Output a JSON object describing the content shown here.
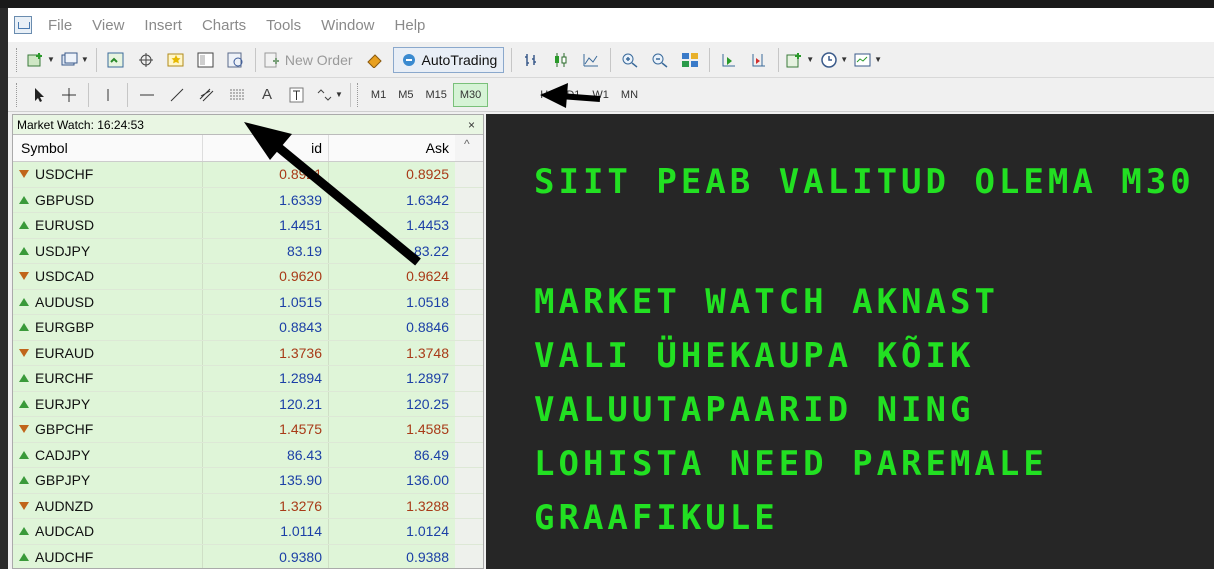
{
  "menu": {
    "items": [
      "File",
      "View",
      "Insert",
      "Charts",
      "Tools",
      "Window",
      "Help"
    ]
  },
  "toolbar1": {
    "new_order_label": "New Order",
    "autotrading_label": "AutoTrading"
  },
  "toolbar2": {
    "timeframes": [
      "M1",
      "M5",
      "M15",
      "M30",
      "H4",
      "D1",
      "W1",
      "MN"
    ],
    "active_timeframe": "M30"
  },
  "market_watch": {
    "title": "Market Watch: 16:24:53",
    "close_label": "×",
    "columns": {
      "symbol": "Symbol",
      "bid": "id",
      "ask": "Ask"
    },
    "rows": [
      {
        "symbol": "USDCHF",
        "dir": "down",
        "bid": "0.8921",
        "ask": "0.8925"
      },
      {
        "symbol": "GBPUSD",
        "dir": "up",
        "bid": "1.6339",
        "ask": "1.6342"
      },
      {
        "symbol": "EURUSD",
        "dir": "up",
        "bid": "1.4451",
        "ask": "1.4453"
      },
      {
        "symbol": "USDJPY",
        "dir": "up",
        "bid": "83.19",
        "ask": "83.22"
      },
      {
        "symbol": "USDCAD",
        "dir": "down",
        "bid": "0.9620",
        "ask": "0.9624"
      },
      {
        "symbol": "AUDUSD",
        "dir": "up",
        "bid": "1.0515",
        "ask": "1.0518"
      },
      {
        "symbol": "EURGBP",
        "dir": "up",
        "bid": "0.8843",
        "ask": "0.8846"
      },
      {
        "symbol": "EURAUD",
        "dir": "down",
        "bid": "1.3736",
        "ask": "1.3748"
      },
      {
        "symbol": "EURCHF",
        "dir": "up",
        "bid": "1.2894",
        "ask": "1.2897"
      },
      {
        "symbol": "EURJPY",
        "dir": "up",
        "bid": "120.21",
        "ask": "120.25"
      },
      {
        "symbol": "GBPCHF",
        "dir": "down",
        "bid": "1.4575",
        "ask": "1.4585"
      },
      {
        "symbol": "CADJPY",
        "dir": "up",
        "bid": "86.43",
        "ask": "86.49"
      },
      {
        "symbol": "GBPJPY",
        "dir": "up",
        "bid": "135.90",
        "ask": "136.00"
      },
      {
        "symbol": "AUDNZD",
        "dir": "down",
        "bid": "1.3276",
        "ask": "1.3288"
      },
      {
        "symbol": "AUDCAD",
        "dir": "up",
        "bid": "1.0114",
        "ask": "1.0124"
      },
      {
        "symbol": "AUDCHF",
        "dir": "up",
        "bid": "0.9380",
        "ask": "0.9388"
      }
    ]
  },
  "annotation": {
    "line1": "SIIT PEAB VALITUD OLEMA M30",
    "line2": "MARKET WATCH AKNAST",
    "line3": "VALI ÜHEKAUPA KÕIK",
    "line4": "VALUUTAPAARID NING",
    "line5": "LOHISTA NEED PAREMALE",
    "line6": "GRAAFIKULE",
    "color": "#22e022"
  },
  "colors": {
    "up_text": "#1b3fa6",
    "down_text": "#a83a17",
    "row_bg": "#dff5d8",
    "dark_panel": "#262626"
  }
}
